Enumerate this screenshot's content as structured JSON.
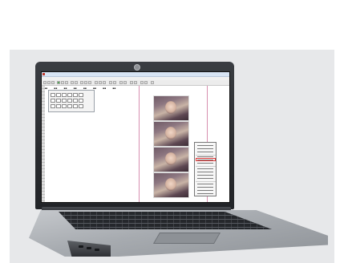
{
  "photo": {
    "subject": "laptop-displaying-layout-software",
    "screen_app": {
      "menu_items": [
        "",
        "",
        "",
        "",
        "",
        "",
        "",
        "",
        "",
        ""
      ],
      "context_menu_item_count": 14
    },
    "colors": {
      "backdrop": "#e7e8ea",
      "laptop_body": "#a7abb0",
      "bezel": "#2a2c30",
      "guide_line": "#d78fb0",
      "menu_highlight": "#e03b3b"
    }
  }
}
